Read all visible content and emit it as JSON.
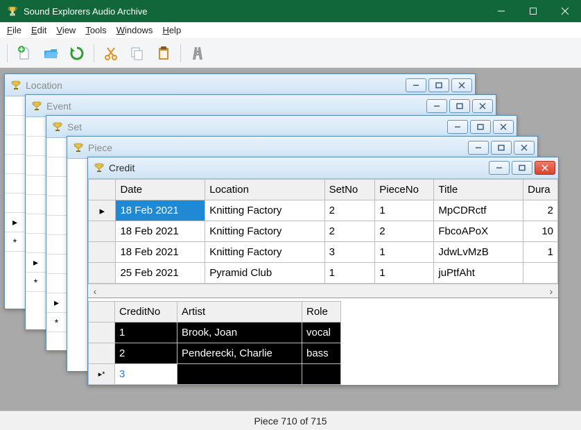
{
  "app": {
    "title": "Sound Explorers Audio Archive"
  },
  "menu": {
    "file": "File",
    "edit": "Edit",
    "view": "View",
    "tools": "Tools",
    "windows": "Windows",
    "help": "Help"
  },
  "child_windows": {
    "location": "Location",
    "event": "Event",
    "set": "Set",
    "piece": "Piece",
    "credit": "Credit"
  },
  "top_grid": {
    "headers": {
      "date": "Date",
      "location": "Location",
      "setno": "SetNo",
      "pieceno": "PieceNo",
      "title": "Title",
      "dura": "Dura"
    },
    "rows": [
      {
        "date": "18 Feb 2021",
        "location": "Knitting Factory",
        "setno": "2",
        "pieceno": "1",
        "title": "MpCDRctf",
        "dura": "2",
        "selected": true
      },
      {
        "date": "18 Feb 2021",
        "location": "Knitting Factory",
        "setno": "2",
        "pieceno": "2",
        "title": "FbcoAPoX",
        "dura": "10"
      },
      {
        "date": "18 Feb 2021",
        "location": "Knitting Factory",
        "setno": "3",
        "pieceno": "1",
        "title": "JdwLvMzB",
        "dura": "1"
      },
      {
        "date": "25 Feb 2021",
        "location": "Pyramid Club",
        "setno": "1",
        "pieceno": "1",
        "title": "juPtfAht",
        "dura": ""
      }
    ]
  },
  "bot_grid": {
    "headers": {
      "creditno": "CreditNo",
      "artist": "Artist",
      "role": "Role"
    },
    "rows": [
      {
        "creditno": "1",
        "artist": "Brook, Joan",
        "role": "vocal"
      },
      {
        "creditno": "2",
        "artist": "Penderecki, Charlie",
        "role": "bass"
      }
    ],
    "newrow": {
      "creditno": "3"
    }
  },
  "status": "Piece 710 of 715"
}
